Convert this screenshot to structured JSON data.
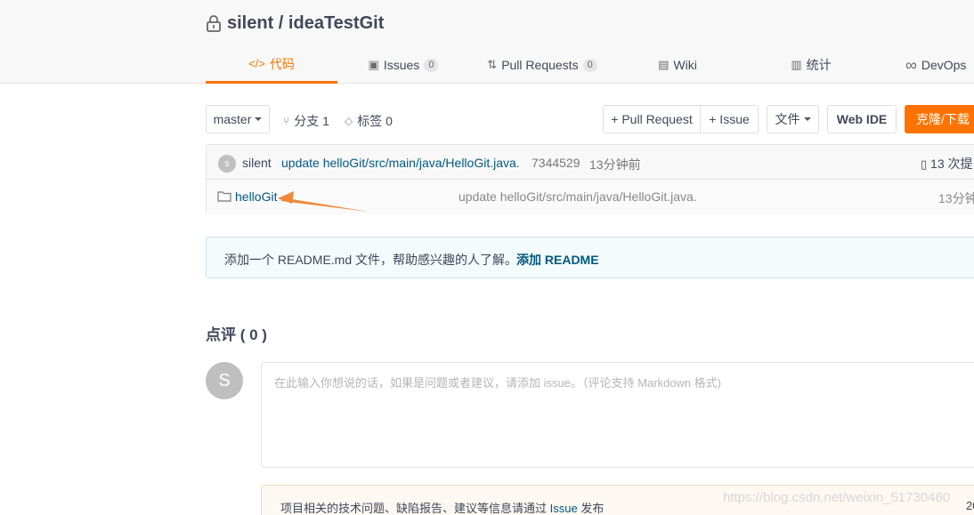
{
  "repo": {
    "owner": "silent",
    "separator": " / ",
    "name": "ideaTestGit"
  },
  "tabs": [
    {
      "icon": "code-icon",
      "glyph": "</>",
      "label": "代码"
    },
    {
      "icon": "issues-icon",
      "glyph": "▣",
      "label": "Issues",
      "count": "0"
    },
    {
      "icon": "pull-request-icon",
      "glyph": "⇅",
      "label": "Pull Requests",
      "count": "0"
    },
    {
      "icon": "wiki-icon",
      "glyph": "▤",
      "label": "Wiki"
    },
    {
      "icon": "stats-icon",
      "glyph": "▥",
      "label": "统计"
    },
    {
      "icon": "devops-icon",
      "glyph": "∞",
      "label": "DevOps"
    }
  ],
  "toolbar": {
    "branch": "master",
    "branches_label": "分支 1",
    "tags_label": "标签 0",
    "pull_request_btn": "+ Pull Request",
    "issue_btn": "+ Issue",
    "files_btn": "文件",
    "webide_btn": "Web IDE",
    "clone_btn": "克隆/下载"
  },
  "commit": {
    "avatar_letter": "s",
    "author": "silent",
    "message": "update helloGit/src/main/java/HelloGit.java.",
    "hash": "7344529",
    "time": "13分钟前",
    "commits_label": "13 次提"
  },
  "files": [
    {
      "name": "helloGit",
      "message": "update helloGit/src/main/java/HelloGit.java.",
      "time": "13分钟"
    }
  ],
  "readme_notice": {
    "text": "添加一个 README.md 文件，帮助感兴趣的人了解。",
    "link": "添加 README"
  },
  "comments": {
    "title": "点评 ( 0 )",
    "avatar_letter": "S",
    "placeholder": "在此输入你想说的话，如果是问题或者建议，请添加 issue。（评论支持 Markdown 格式)"
  },
  "issue_notice": {
    "prefix": "项目相关的技术问题、缺陷报告、建议等信息请通过 ",
    "link": "Issue",
    "suffix": " 发布",
    "trailing": "20"
  },
  "watermark": "https://blog.csdn.net/weixin_51730460",
  "colors": {
    "accent": "#fe7300",
    "link": "#005980",
    "text": "#40485b",
    "arrow": "#f0883a"
  }
}
